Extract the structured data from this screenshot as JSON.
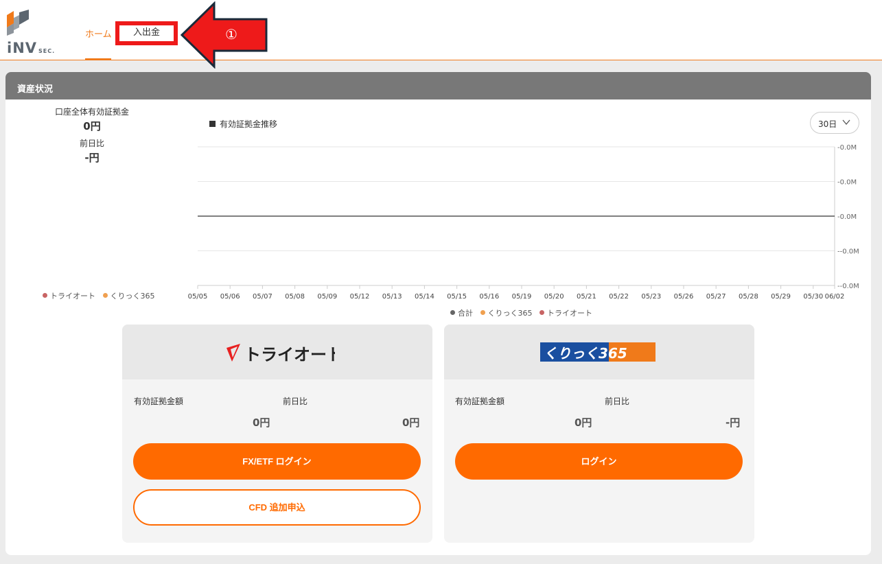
{
  "header": {
    "logo_text": "iNV",
    "logo_sec": "SEC.",
    "nav_home": "ホーム",
    "nav_deposit": "入出金",
    "callout_number": "①"
  },
  "panel": {
    "title": "資産状況",
    "summary": {
      "total_label": "口座全体有効証拠金",
      "total_value": "0円",
      "diff_label": "前日比",
      "diff_value": "-円"
    },
    "left_legend": [
      {
        "label": "トライオート",
        "color": "#c86464"
      },
      {
        "label": "くりっく365",
        "color": "#f0a050"
      }
    ],
    "period_select": "30日"
  },
  "chart_data": {
    "type": "line",
    "title": "有効証拠金推移",
    "x": [
      "05/05",
      "05/06",
      "05/07",
      "05/08",
      "05/09",
      "05/12",
      "05/13",
      "05/14",
      "05/15",
      "05/16",
      "05/19",
      "05/20",
      "05/21",
      "05/22",
      "05/23",
      "05/26",
      "05/27",
      "05/28",
      "05/29",
      "05/30",
      "06/02"
    ],
    "y_ticks": [
      "0.0M",
      "0.0M",
      "0.0M",
      "-0.0M",
      "-0.0M"
    ],
    "series": [
      {
        "name": "合計",
        "color": "#666666",
        "values": [
          0,
          0,
          0,
          0,
          0,
          0,
          0,
          0,
          0,
          0,
          0,
          0,
          0,
          0,
          0,
          0,
          0,
          0,
          0,
          0,
          0
        ]
      },
      {
        "name": "くりっく365",
        "color": "#f0a050",
        "values": [
          0,
          0,
          0,
          0,
          0,
          0,
          0,
          0,
          0,
          0,
          0,
          0,
          0,
          0,
          0,
          0,
          0,
          0,
          0,
          0,
          0
        ]
      },
      {
        "name": "トライオート",
        "color": "#c86464",
        "values": [
          0,
          0,
          0,
          0,
          0,
          0,
          0,
          0,
          0,
          0,
          0,
          0,
          0,
          0,
          0,
          0,
          0,
          0,
          0,
          0,
          0
        ]
      }
    ],
    "ylim": [
      -1,
      1
    ],
    "grid": true,
    "legend": "bottom"
  },
  "cards": {
    "triauto": {
      "logo_text": "トライオート",
      "margin_label": "有効証拠金額",
      "diff_label": "前日比",
      "margin_value": "0円",
      "diff_value": "0円",
      "login_button": "FX/ETF ログイン",
      "cfd_button": "CFD 追加申込"
    },
    "click365": {
      "logo_text": "くりっく365",
      "margin_label": "有効証拠金額",
      "diff_label": "前日比",
      "margin_value": "0円",
      "diff_value": "-円",
      "login_button": "ログイン"
    }
  },
  "colors": {
    "accent": "#ff6a00",
    "callout_red": "#ee1a1a",
    "panel_header": "#787878"
  }
}
